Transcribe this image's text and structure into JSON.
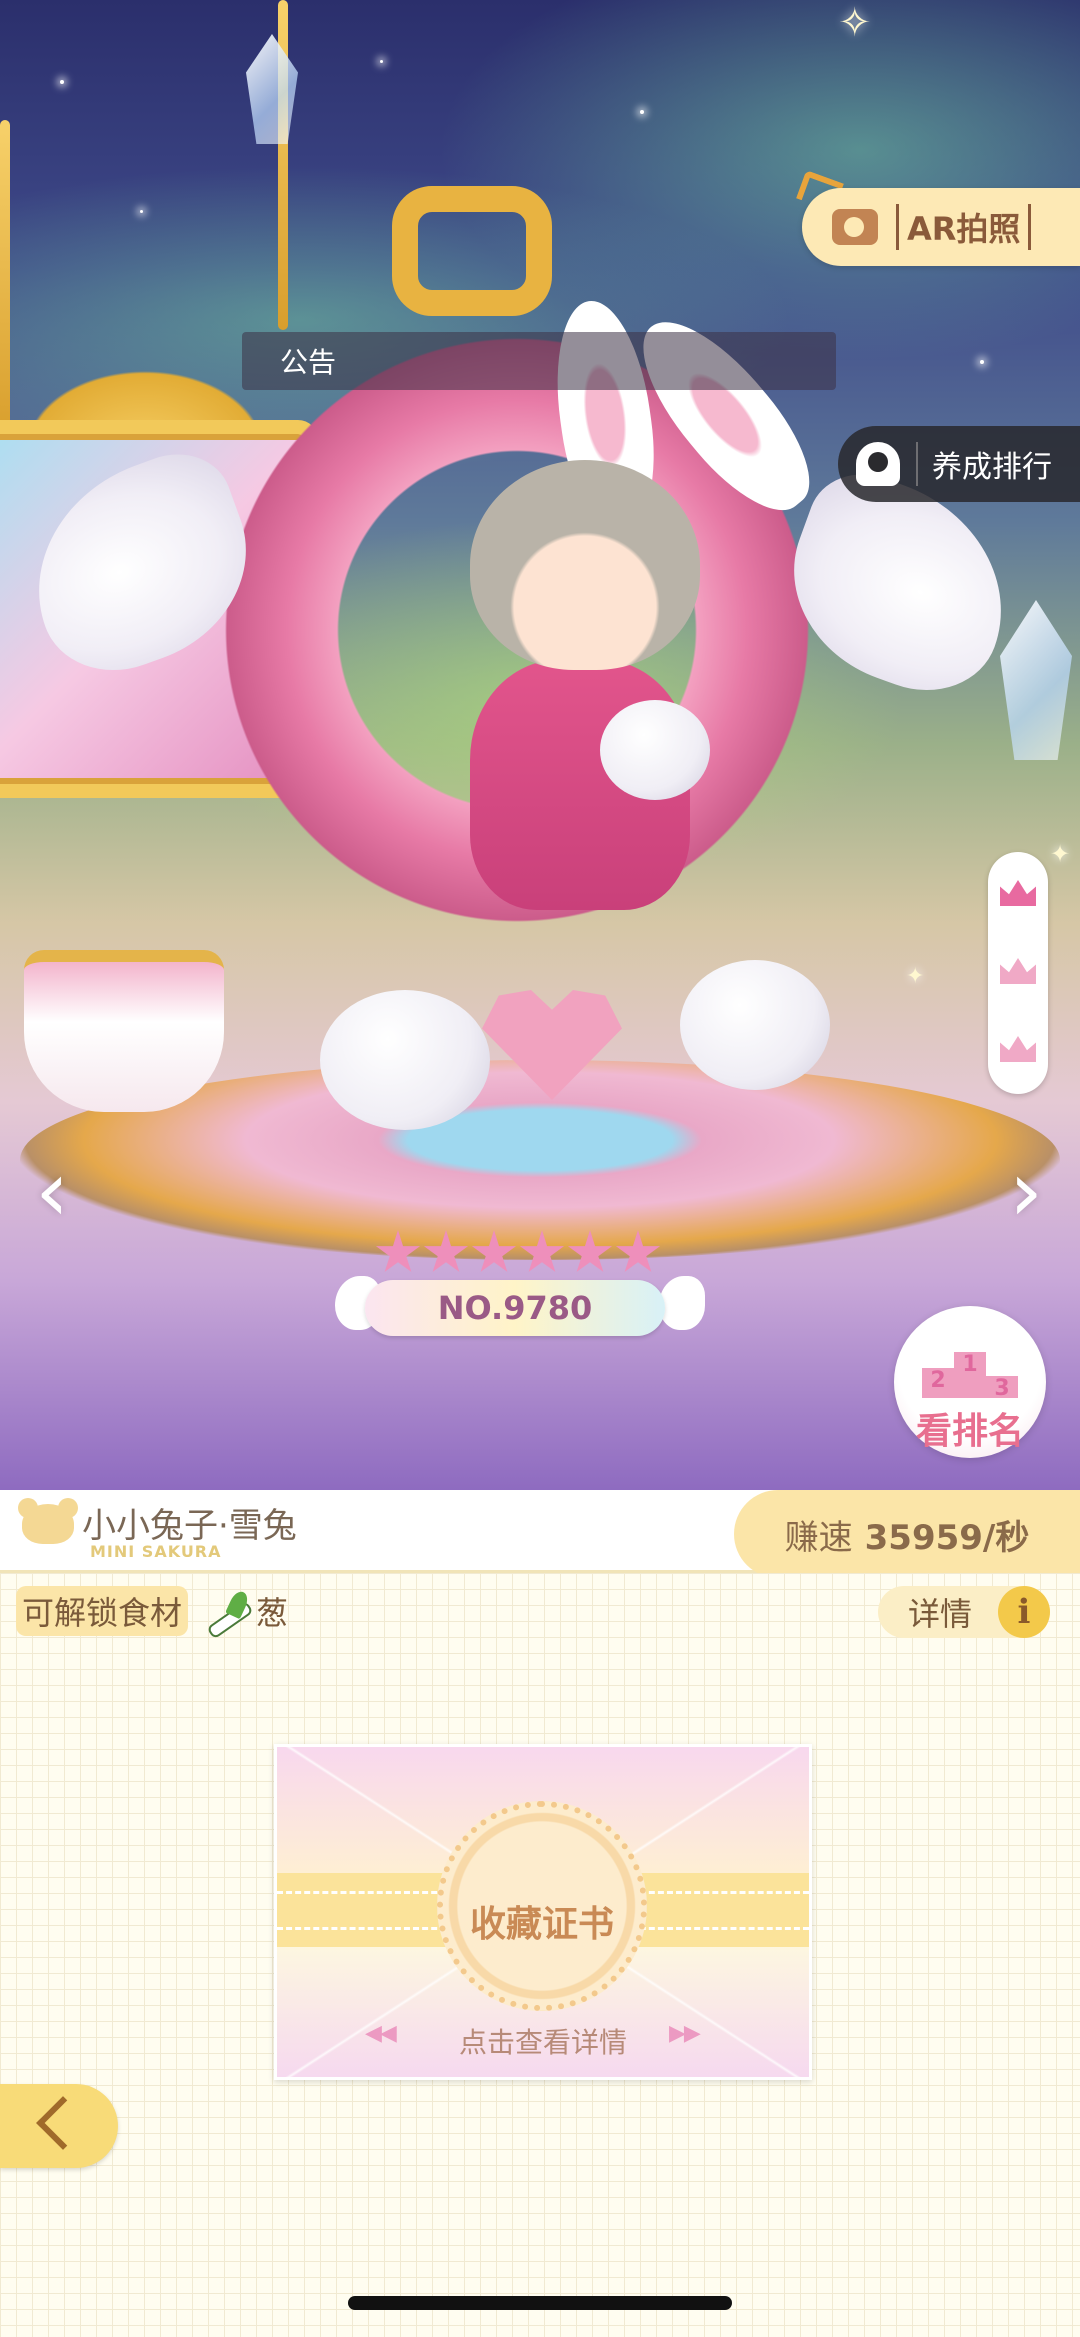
{
  "scene": {
    "notice_label": "公告",
    "ar_button_label": "AR拍照",
    "ranking_button_label": "养成排行",
    "level_badge_number": "NO.9780",
    "level_stars": 6,
    "leaderboard_label": "看排名",
    "leaderboard_places": [
      "2",
      "1",
      "3"
    ]
  },
  "character": {
    "name": "小小兔子·雪兔",
    "series": "MINI SAKURA"
  },
  "speed": {
    "label": "赚速",
    "value": "35959/秒"
  },
  "ingredients": {
    "label": "可解锁食材",
    "item": "葱",
    "item_icon": "leek-icon"
  },
  "details_button": {
    "label": "详情",
    "icon": "info-icon"
  },
  "certificate": {
    "title": "收藏证书",
    "cta": "点击查看详情"
  },
  "colors": {
    "accent_yellow": "#fbe5a8",
    "accent_pink": "#e86aa0",
    "text_brown": "#7a5a3a"
  }
}
